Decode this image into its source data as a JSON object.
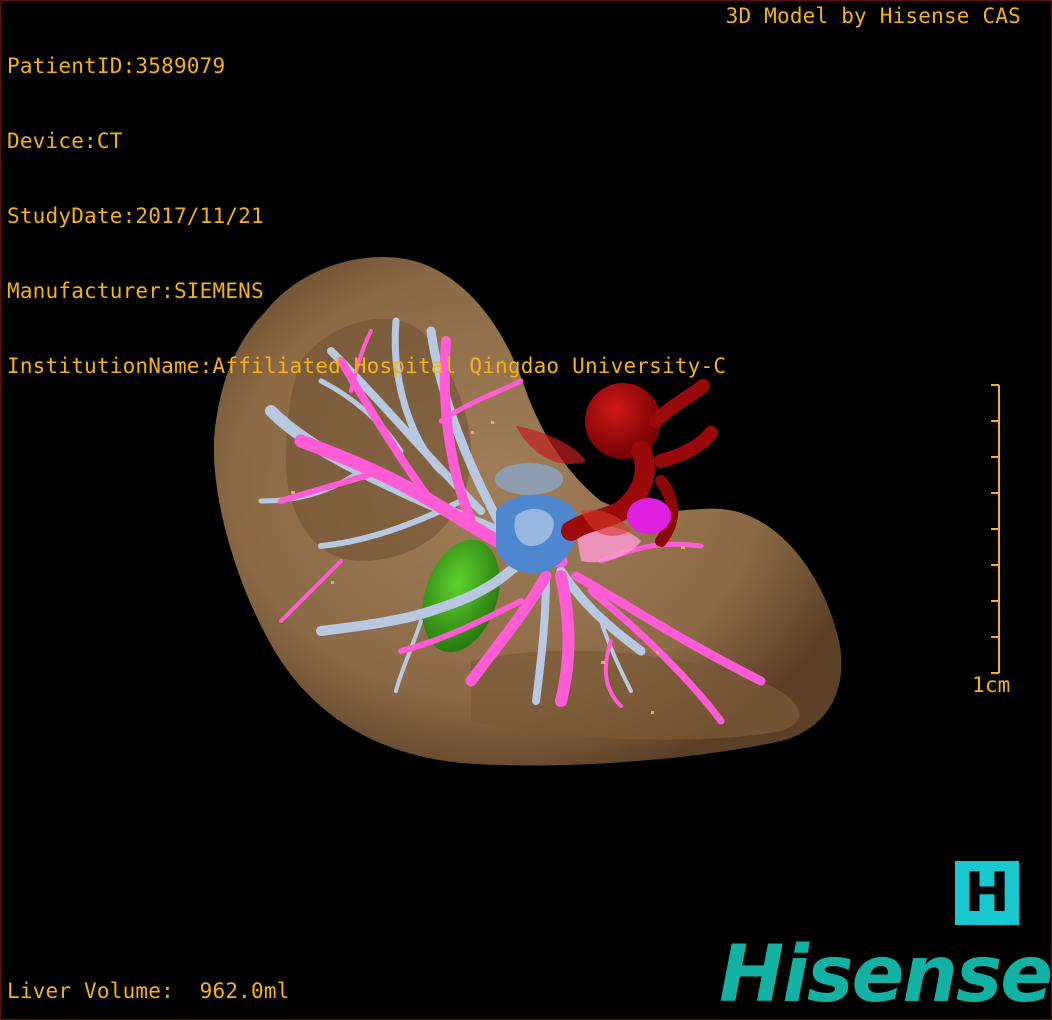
{
  "header": {
    "patient_id": "PatientID:3589079",
    "device": "Device:CT",
    "study_date": "StudyDate:2017/11/21",
    "manufacturer": "Manufacturer:SIEMENS",
    "institution": "InstitutionName:Affiliated Hospital Qingdao University-C",
    "model_credit": "3D Model by Hisense CAS"
  },
  "footer": {
    "liver_volume": "Liver Volume:  962.0ml"
  },
  "scale": {
    "label": "1cm",
    "tick_count": 9
  },
  "branding": {
    "badge_letter": "H",
    "logo_text": "Hisense"
  },
  "colors": {
    "overlay_text": "#f5b21a",
    "liver": "#8c6a46",
    "portal_vein": "#ff5cd6",
    "hepatic_vein": "#b8c8e0",
    "gallbladder": "#3fae1c",
    "artery": "#b00808",
    "brand": "#13b0a4",
    "badge": "#17c9cf"
  }
}
